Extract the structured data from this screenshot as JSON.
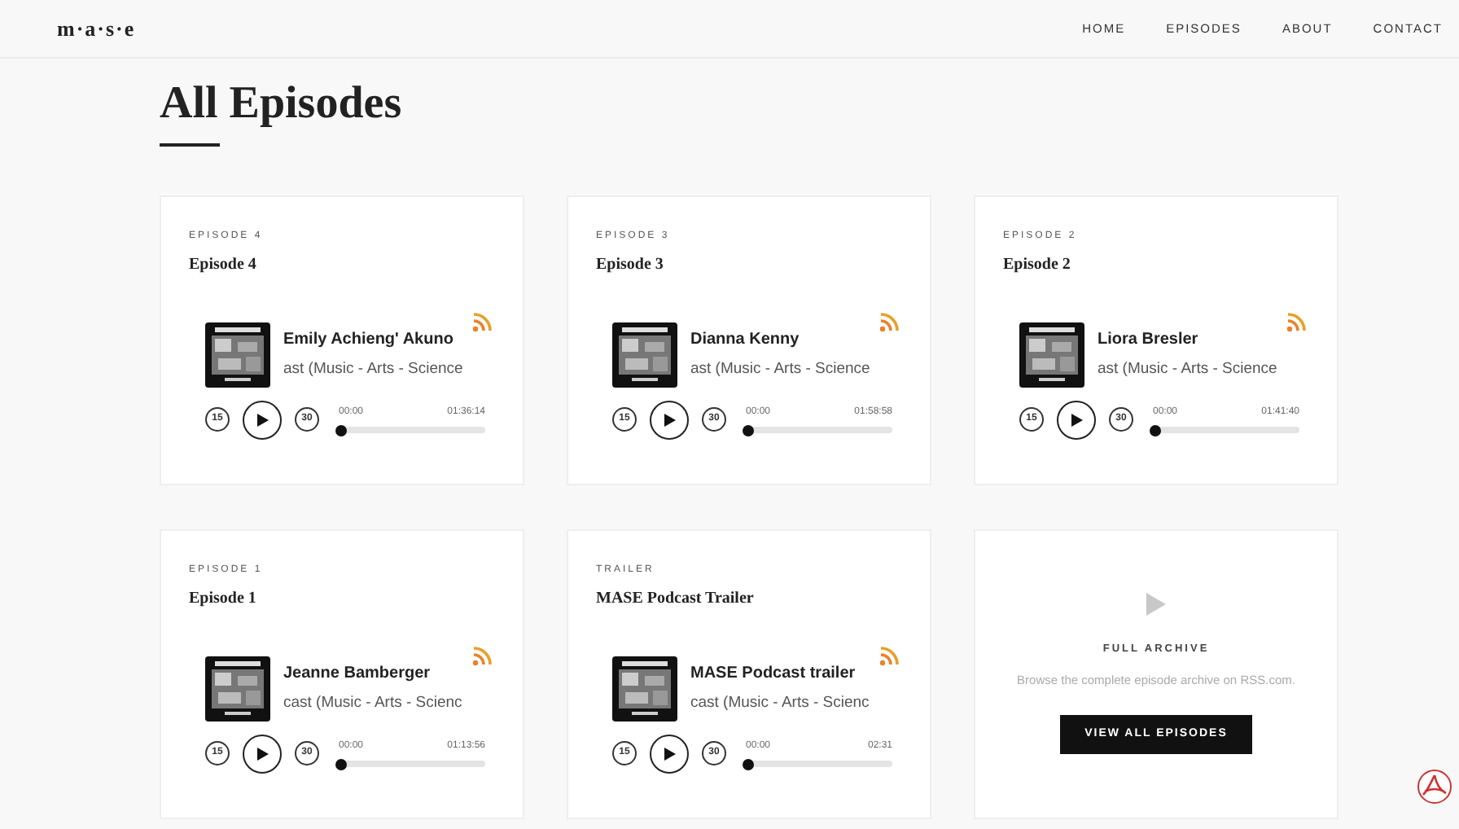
{
  "nav": {
    "logo": "m·a·s·e",
    "links": [
      {
        "label": "HOME",
        "selected": false
      },
      {
        "label": "EPISODES",
        "selected": false
      },
      {
        "label": "ABOUT",
        "selected": false
      },
      {
        "label": "CONTACT",
        "selected": false
      }
    ]
  },
  "page_title": "All Episodes",
  "episodes": [
    {
      "kind": "episode",
      "eyebrow": "EPISODE 4",
      "title": "Episode 4",
      "player": {
        "title": "Emily Achieng' Akuno",
        "subtitle": "ast (Music - Arts - Science",
        "skip_back": "15",
        "skip_forward": "30",
        "elapsed": "00:00",
        "duration": "01:36:14",
        "level": 0
      }
    },
    {
      "kind": "episode",
      "eyebrow": "EPISODE 3",
      "title": "Episode 3",
      "player": {
        "title": "Dianna Kenny",
        "subtitle": "ast (Music - Arts - Science",
        "skip_back": "15",
        "skip_forward": "30",
        "elapsed": "00:00",
        "duration": "01:58:58",
        "level": 0
      }
    },
    {
      "kind": "episode",
      "eyebrow": "EPISODE 2",
      "title": "Episode 2",
      "player": {
        "title": "Liora Bresler",
        "subtitle": "ast (Music - Arts - Science",
        "skip_back": "15",
        "skip_forward": "30",
        "elapsed": "00:00",
        "duration": "01:41:40",
        "level": 0
      }
    },
    {
      "kind": "episode",
      "eyebrow": "EPISODE 1",
      "title": "Episode 1",
      "player": {
        "title": "Jeanne Bamberger",
        "subtitle": "cast (Music - Arts - Scienc",
        "skip_back": "15",
        "skip_forward": "30",
        "elapsed": "00:00",
        "duration": "01:13:56",
        "level": 0
      }
    },
    {
      "kind": "episode",
      "eyebrow": "TRAILER",
      "title": "MASE Podcast Trailer",
      "player": {
        "title": "MASE Podcast trailer",
        "subtitle": "cast (Music - Arts - Scienc",
        "skip_back": "15",
        "skip_forward": "30",
        "elapsed": "00:00",
        "duration": "02:31",
        "level": 0
      }
    },
    {
      "kind": "archive",
      "heading": "FULL ARCHIVE",
      "text": "Browse the complete episode archive on RSS.com.",
      "button": "VIEW ALL EPISODES"
    }
  ]
}
